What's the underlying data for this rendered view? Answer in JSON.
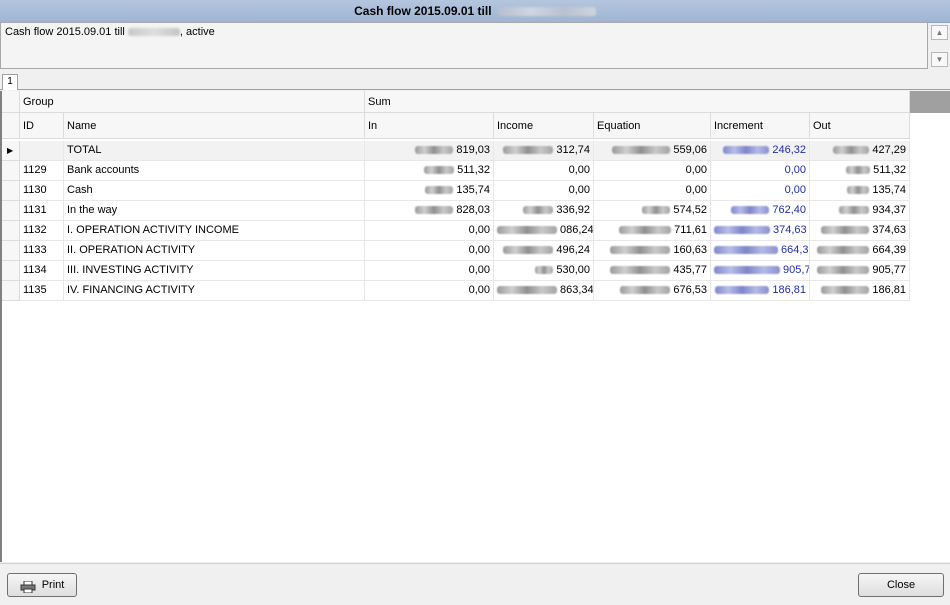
{
  "window": {
    "title": "Cash flow 2015.09.01 till"
  },
  "info": {
    "prefix": "Cash flow 2015.09.01 till",
    "suffix": ", active"
  },
  "tab": {
    "label": "1"
  },
  "grid": {
    "group_headers": [
      "Group",
      "Sum"
    ],
    "columns": [
      "ID",
      "Name",
      "In",
      "Income",
      "Equation",
      "Increment",
      "Out"
    ],
    "rows": [
      {
        "id": "",
        "name": "TOTAL",
        "in": "819,03",
        "income": "312,74",
        "equation": "559,06",
        "increment": "246,32",
        "out": "427,29"
      },
      {
        "id": "1129",
        "name": "Bank accounts",
        "in": "511,32",
        "income": "0,00",
        "equation": "0,00",
        "increment": "0,00",
        "out": "511,32"
      },
      {
        "id": "1130",
        "name": "Cash",
        "in": "135,74",
        "income": "0,00",
        "equation": "0,00",
        "increment": "0,00",
        "out": "135,74"
      },
      {
        "id": "1131",
        "name": "In the way",
        "in": "828,03",
        "income": "336,92",
        "equation": "574,52",
        "increment": "762,40",
        "out": "934,37"
      },
      {
        "id": "1132",
        "name": "I. OPERATION ACTIVITY INCOME",
        "in": "0,00",
        "income": "086,24",
        "equation": "711,61",
        "increment": "374,63",
        "out": "374,63"
      },
      {
        "id": "1133",
        "name": "II. OPERATION ACTIVITY",
        "in": "0,00",
        "income": "496,24",
        "equation": "160,63",
        "increment": "664,39",
        "out": "664,39"
      },
      {
        "id": "1134",
        "name": "III. INVESTING ACTIVITY",
        "in": "0,00",
        "income": "530,00",
        "equation": "435,77",
        "increment": "905,77",
        "out": "905,77"
      },
      {
        "id": "1135",
        "name": "IV. FINANCING ACTIVITY",
        "in": "0,00",
        "income": "863,34",
        "equation": "676,53",
        "increment": "186,81",
        "out": "186,81"
      }
    ]
  },
  "buttons": {
    "print": "Print",
    "close": "Close"
  },
  "icons": {
    "print": "printer-icon",
    "row_indicator": "triangle-right-icon",
    "scroll_up": "chevron-up-icon",
    "scroll_down": "chevron-down-icon"
  },
  "colors": {
    "titlebar": "#9fb5d3",
    "increment_text": "#1f2fa8"
  }
}
